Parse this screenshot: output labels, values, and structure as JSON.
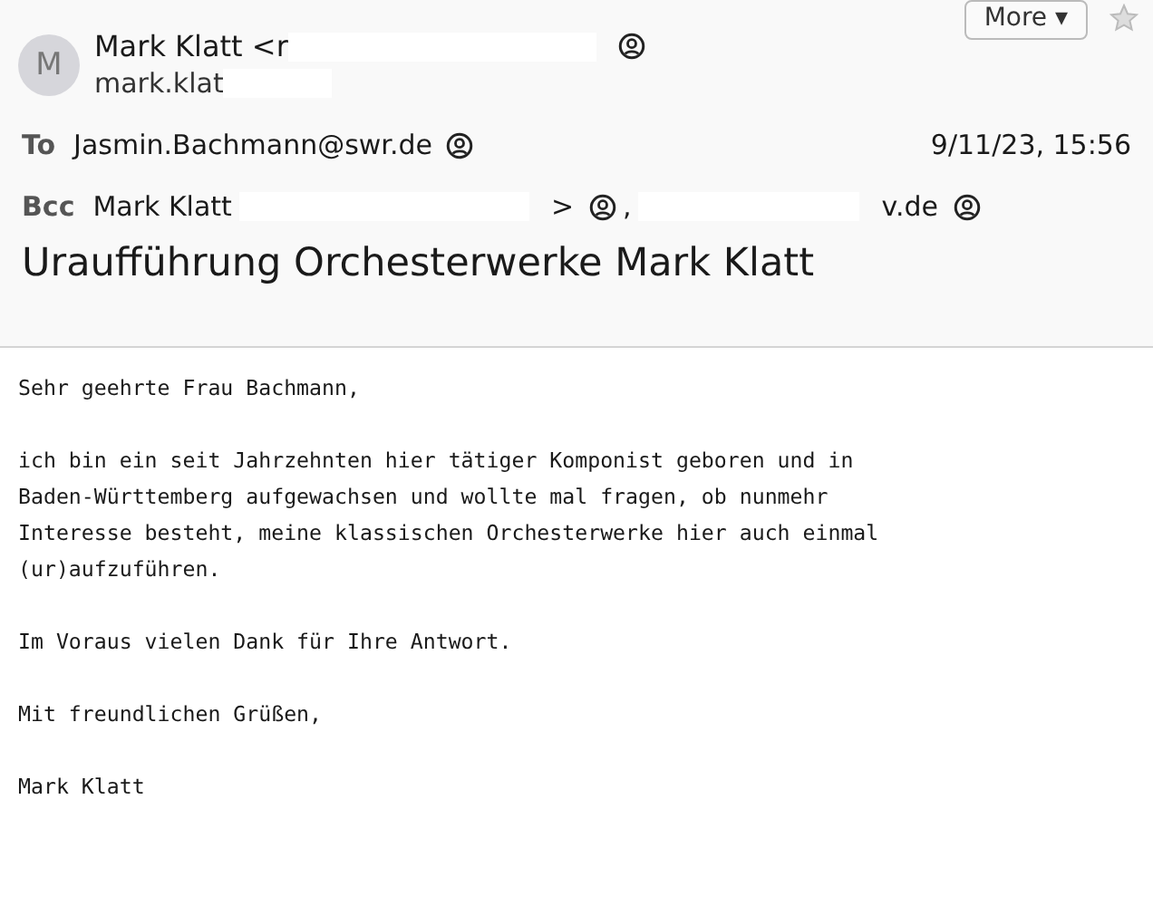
{
  "toolbar": {
    "more_button": "More ▾"
  },
  "sender": {
    "avatar_letter": "M",
    "name": "Mark Klatt <r",
    "address": "mark.klat"
  },
  "to": {
    "label": "To",
    "recipient": "Jasmin.Bachmann@swr.de",
    "date": "9/11/23, 15:56"
  },
  "bcc": {
    "label": "Bcc",
    "recipients": [
      {
        "before": "Mark Klatt",
        "after": ">"
      },
      {
        "before": ",",
        "after": "v.de"
      }
    ]
  },
  "subject": "Uraufführung Orchesterwerke Mark Klatt",
  "body": [
    "Sehr geehrte Frau Bachmann,",
    "ich bin ein seit Jahrzehnten hier tätiger Komponist geboren und in\nBaden-Württemberg aufgewachsen und wollte mal fragen, ob nunmehr\nInteresse besteht, meine klassischen Orchesterwerke hier auch einmal\n(ur)aufzuführen.",
    "Im Voraus vielen Dank für Ihre Antwort.",
    "Mit freundlichen Grüßen,",
    "Mark Klatt"
  ]
}
